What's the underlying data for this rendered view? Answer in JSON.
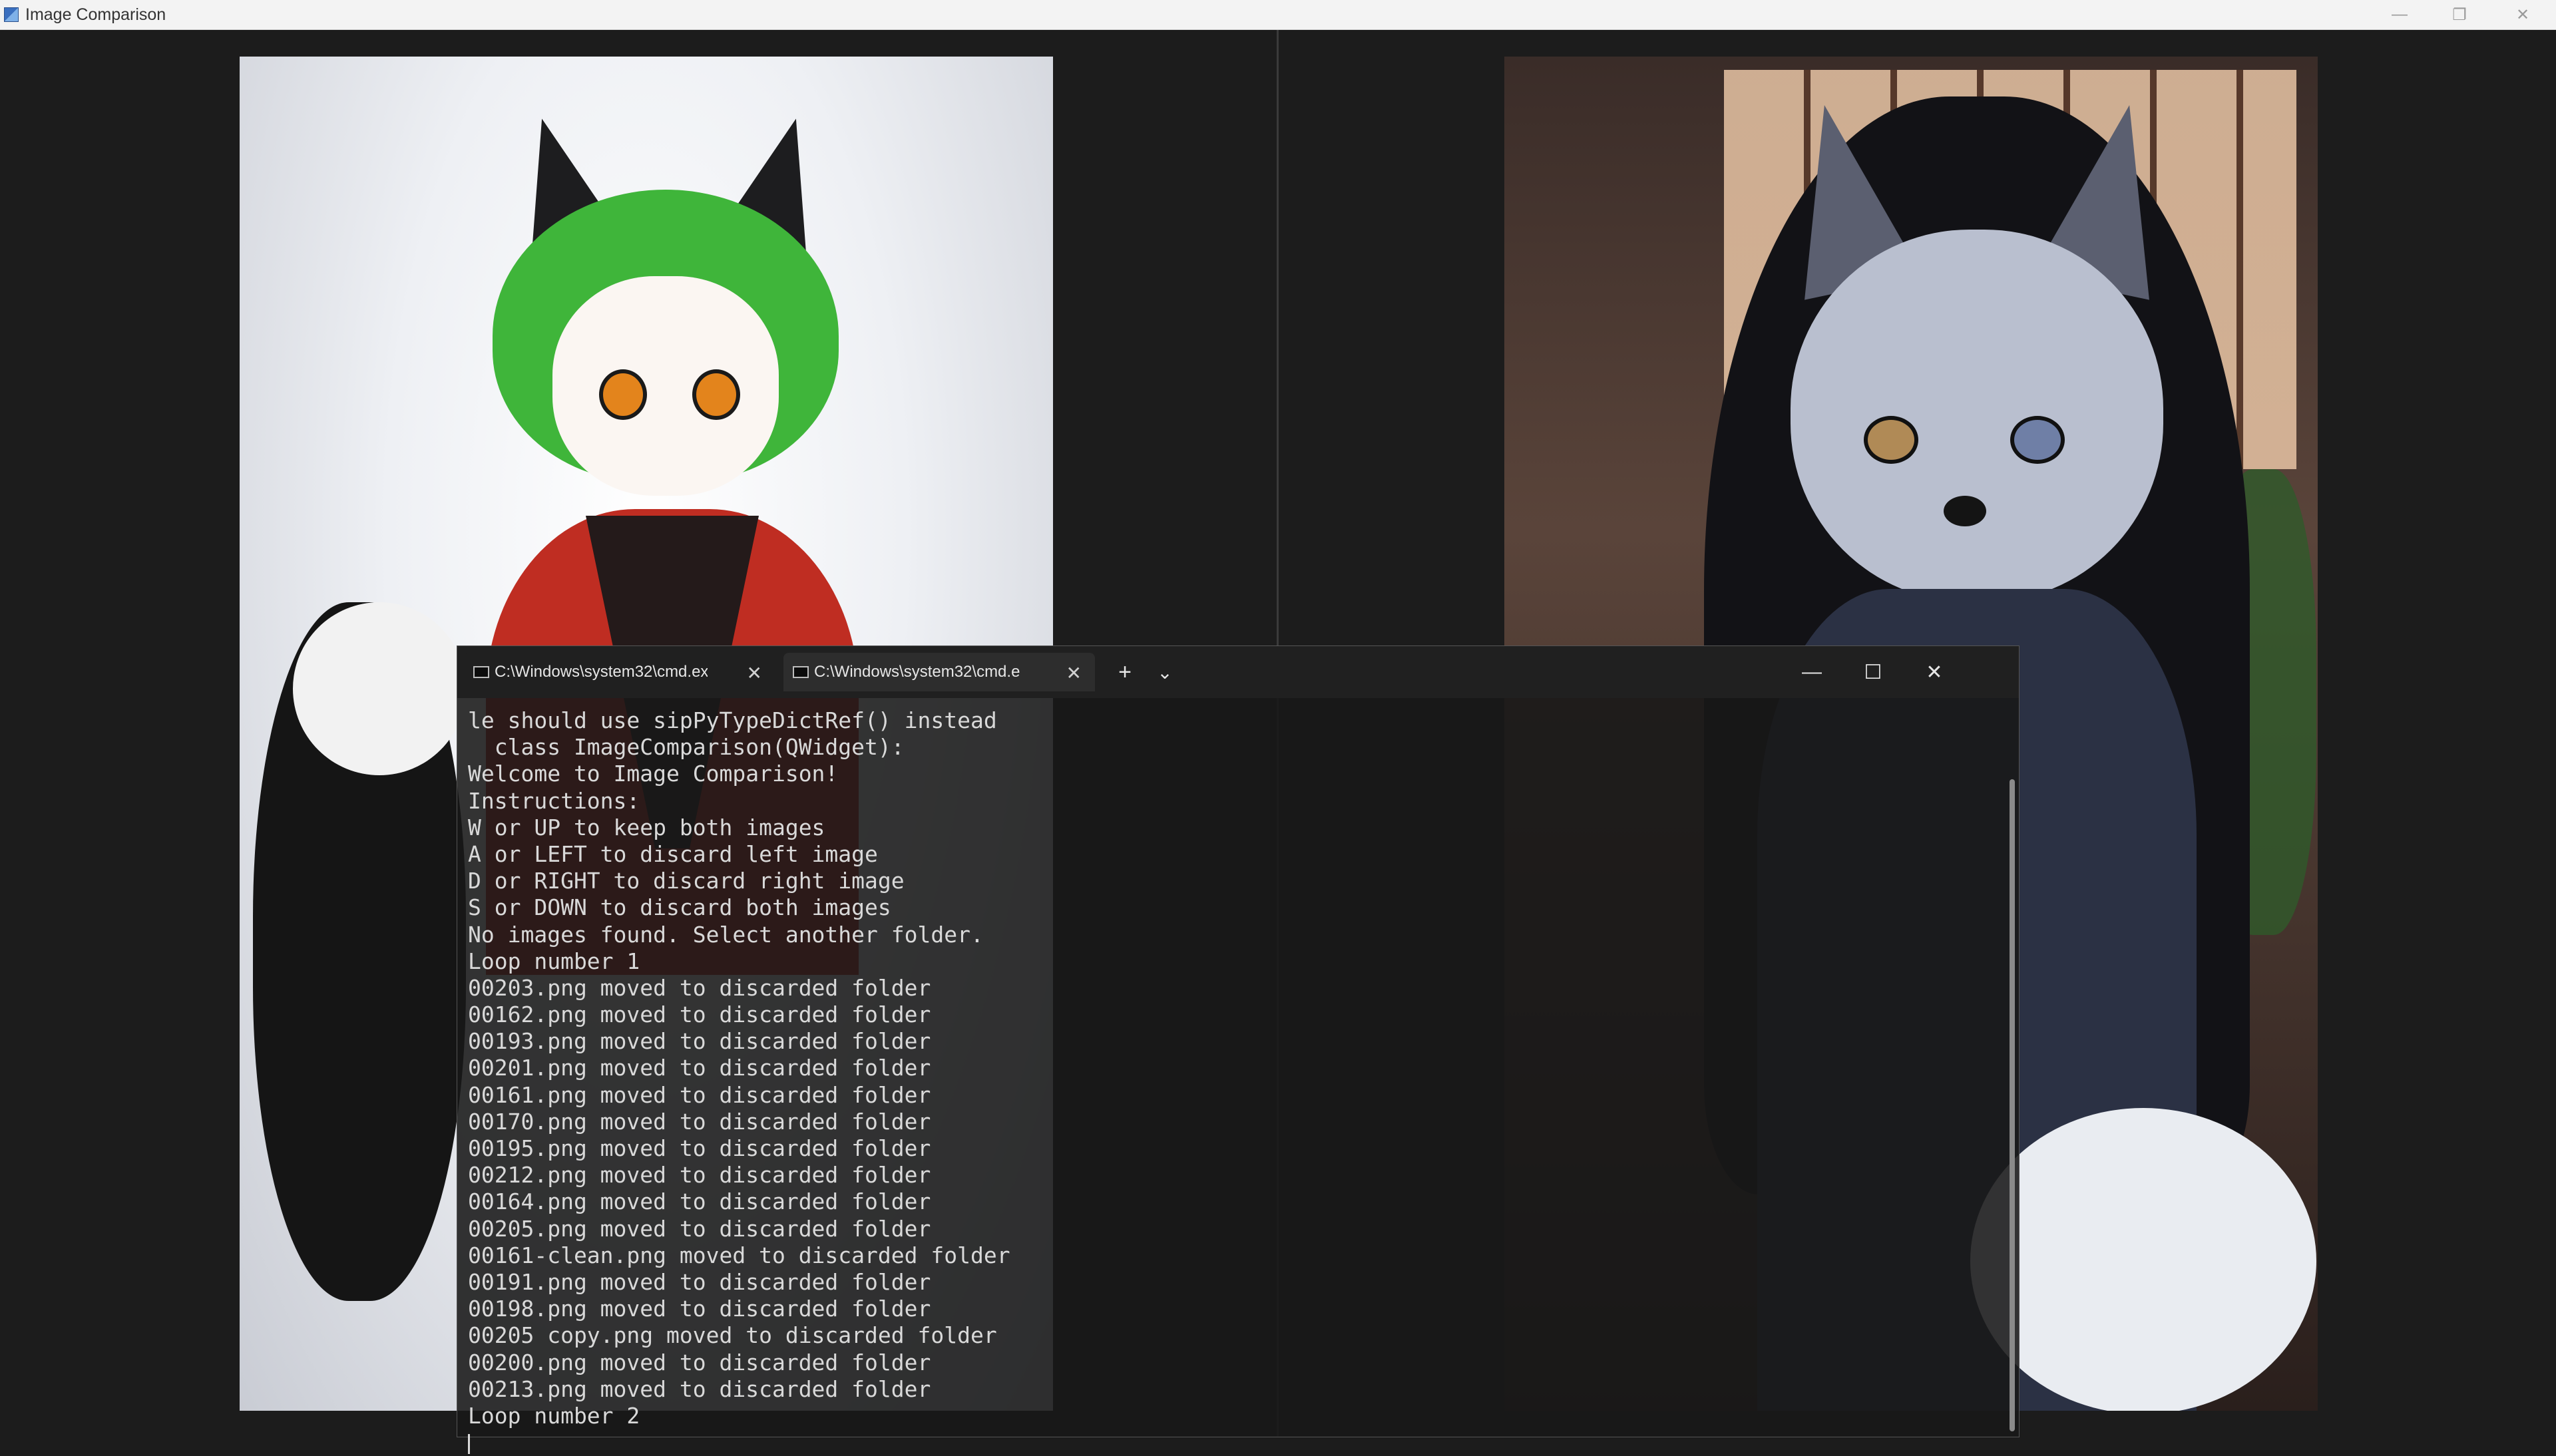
{
  "app": {
    "title": "Image Comparison",
    "controls": {
      "minimize": "—",
      "restore": "❐",
      "close": "✕"
    }
  },
  "terminal": {
    "tabs": [
      {
        "label": "C:\\Windows\\system32\\cmd.ex",
        "active": false
      },
      {
        "label": "C:\\Windows\\system32\\cmd.e",
        "active": true
      }
    ],
    "new_tab": "+",
    "dropdown": "⌄",
    "controls": {
      "minimize": "—",
      "maximize": "☐",
      "close": "✕"
    },
    "lines": [
      "le should use sipPyTypeDictRef() instead",
      "  class ImageComparison(QWidget):",
      "Welcome to Image Comparison!",
      "Instructions:",
      "W or UP to keep both images",
      "A or LEFT to discard left image",
      "D or RIGHT to discard right image",
      "S or DOWN to discard both images",
      "No images found. Select another folder.",
      "Loop number 1",
      "00203.png moved to discarded folder",
      "00162.png moved to discarded folder",
      "00193.png moved to discarded folder",
      "00201.png moved to discarded folder",
      "00161.png moved to discarded folder",
      "00170.png moved to discarded folder",
      "00195.png moved to discarded folder",
      "00212.png moved to discarded folder",
      "00164.png moved to discarded folder",
      "00205.png moved to discarded folder",
      "00161-clean.png moved to discarded folder",
      "00191.png moved to discarded folder",
      "00198.png moved to discarded folder",
      "00205 copy.png moved to discarded folder",
      "00200.png moved to discarded folder",
      "00213.png moved to discarded folder",
      "Loop number 2"
    ]
  }
}
